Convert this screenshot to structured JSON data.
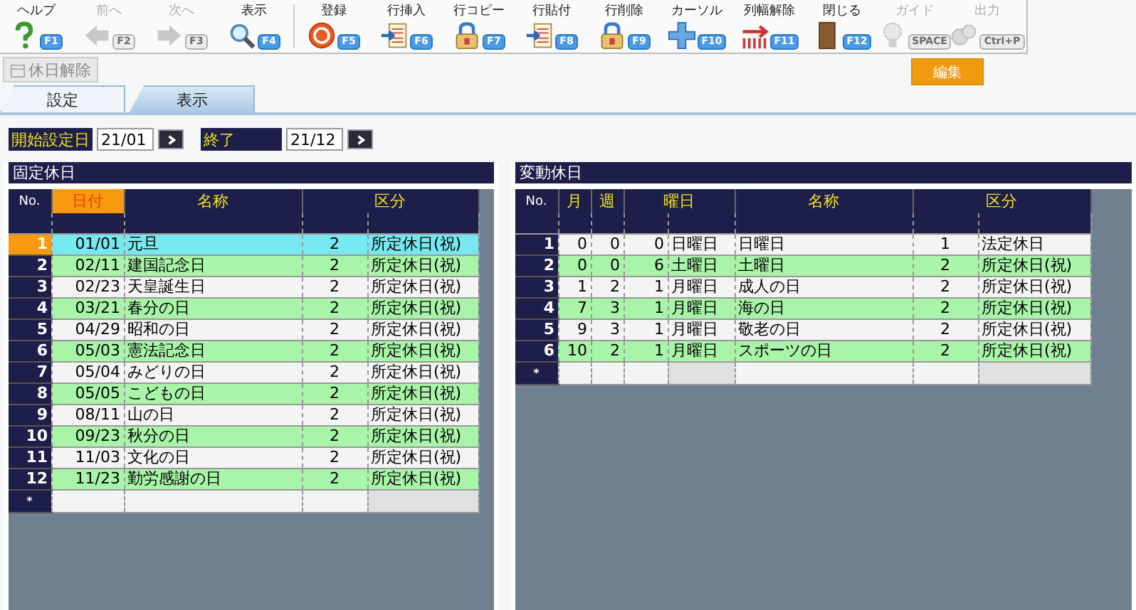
{
  "toolbar": [
    {
      "items": [
        {
          "label": "ヘルプ",
          "key": "F1",
          "disabled": false
        },
        {
          "label": "前へ",
          "key": "F2",
          "disabled": true
        },
        {
          "label": "次へ",
          "key": "F3",
          "disabled": true
        },
        {
          "label": "表示",
          "key": "F4",
          "disabled": false
        }
      ]
    },
    {
      "items": [
        {
          "label": "登録",
          "key": "F5",
          "disabled": false
        },
        {
          "label": "行挿入",
          "key": "F6",
          "disabled": false
        },
        {
          "label": "行コピー",
          "key": "F7",
          "disabled": false
        },
        {
          "label": "行貼付",
          "key": "F8",
          "disabled": false
        },
        {
          "label": "行削除",
          "key": "F9",
          "disabled": false
        },
        {
          "label": "カーソル",
          "key": "F10",
          "disabled": false
        },
        {
          "label": "列幅解除",
          "key": "F11",
          "disabled": false
        },
        {
          "label": "閉じる",
          "key": "F12",
          "disabled": false
        },
        {
          "label": "ガイド",
          "key": "SPACE",
          "disabled": true
        },
        {
          "label": "出力",
          "key": "Ctrl+P",
          "disabled": true
        }
      ]
    }
  ],
  "holiday_release_button": {
    "label": "休日解除",
    "disabled": true
  },
  "mode_badge": "編集",
  "tabs": [
    {
      "label": "設定",
      "selected": true
    },
    {
      "label": "表示",
      "selected": false
    }
  ],
  "date_range": {
    "start_label": "開始設定日",
    "start_value": "21/01",
    "end_label": "終了",
    "end_value": "21/12"
  },
  "fixed_holidays": {
    "title": "固定休日",
    "columns": [
      {
        "label": "No.",
        "selected": false
      },
      {
        "label": "日付",
        "selected": true
      },
      {
        "label": "名称",
        "selected": false
      },
      {
        "label": "区分",
        "selected": false
      }
    ],
    "rows": [
      {
        "no": "1",
        "date": "01/01",
        "name": "元旦",
        "code": "2",
        "category": "所定休日(祝)",
        "selected": true
      },
      {
        "no": "2",
        "date": "02/11",
        "name": "建国記念日",
        "code": "2",
        "category": "所定休日(祝)",
        "selected": false
      },
      {
        "no": "3",
        "date": "02/23",
        "name": "天皇誕生日",
        "code": "2",
        "category": "所定休日(祝)",
        "selected": false
      },
      {
        "no": "4",
        "date": "03/21",
        "name": "春分の日",
        "code": "2",
        "category": "所定休日(祝)",
        "selected": false
      },
      {
        "no": "5",
        "date": "04/29",
        "name": "昭和の日",
        "code": "2",
        "category": "所定休日(祝)",
        "selected": false
      },
      {
        "no": "6",
        "date": "05/03",
        "name": "憲法記念日",
        "code": "2",
        "category": "所定休日(祝)",
        "selected": false
      },
      {
        "no": "7",
        "date": "05/04",
        "name": "みどりの日",
        "code": "2",
        "category": "所定休日(祝)",
        "selected": false
      },
      {
        "no": "8",
        "date": "05/05",
        "name": "こどもの日",
        "code": "2",
        "category": "所定休日(祝)",
        "selected": false
      },
      {
        "no": "9",
        "date": "08/11",
        "name": "山の日",
        "code": "2",
        "category": "所定休日(祝)",
        "selected": false
      },
      {
        "no": "10",
        "date": "09/23",
        "name": "秋分の日",
        "code": "2",
        "category": "所定休日(祝)",
        "selected": false
      },
      {
        "no": "11",
        "date": "11/03",
        "name": "文化の日",
        "code": "2",
        "category": "所定休日(祝)",
        "selected": false
      },
      {
        "no": "12",
        "date": "11/23",
        "name": "勤労感謝の日",
        "code": "2",
        "category": "所定休日(祝)",
        "selected": false
      }
    ],
    "new_row_marker": "*"
  },
  "variable_holidays": {
    "title": "変動休日",
    "columns": [
      {
        "label": "No."
      },
      {
        "label": "月"
      },
      {
        "label": "週"
      },
      {
        "label": "曜日"
      },
      {
        "label": "名称"
      },
      {
        "label": "区分"
      }
    ],
    "rows": [
      {
        "no": "1",
        "month": "0",
        "week": "0",
        "weekday_no": "0",
        "weekday": "日曜日",
        "name": "日曜日",
        "code": "1",
        "category": "法定休日"
      },
      {
        "no": "2",
        "month": "0",
        "week": "0",
        "weekday_no": "6",
        "weekday": "土曜日",
        "name": "土曜日",
        "code": "2",
        "category": "所定休日(祝)"
      },
      {
        "no": "3",
        "month": "1",
        "week": "2",
        "weekday_no": "1",
        "weekday": "月曜日",
        "name": "成人の日",
        "code": "2",
        "category": "所定休日(祝)"
      },
      {
        "no": "4",
        "month": "7",
        "week": "3",
        "weekday_no": "1",
        "weekday": "月曜日",
        "name": "海の日",
        "code": "2",
        "category": "所定休日(祝)"
      },
      {
        "no": "5",
        "month": "9",
        "week": "3",
        "weekday_no": "1",
        "weekday": "月曜日",
        "name": "敬老の日",
        "code": "2",
        "category": "所定休日(祝)"
      },
      {
        "no": "6",
        "month": "10",
        "week": "2",
        "weekday_no": "1",
        "weekday": "月曜日",
        "name": "スポーツの日",
        "code": "2",
        "category": "所定休日(祝)"
      }
    ],
    "new_row_marker": "*"
  }
}
